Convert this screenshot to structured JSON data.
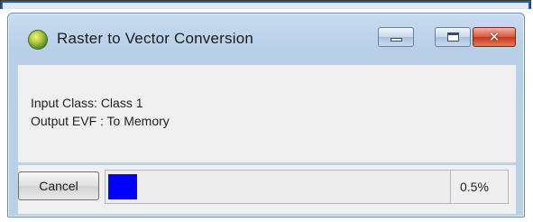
{
  "window": {
    "title": "Raster to Vector Conversion",
    "icon": "app-globe-icon",
    "controls": {
      "minimize": "minimize-icon",
      "maximize": "maximize-icon",
      "close": "close-icon",
      "close_glyph": "✕"
    }
  },
  "status": {
    "input_line": "Input Class: Class 1",
    "output_line": "Output EVF : To Memory"
  },
  "actions": {
    "cancel_label": "Cancel"
  },
  "progress": {
    "percent_label": "0.5%",
    "value_fraction": 0.005,
    "fill_color": "#0000ff"
  }
}
